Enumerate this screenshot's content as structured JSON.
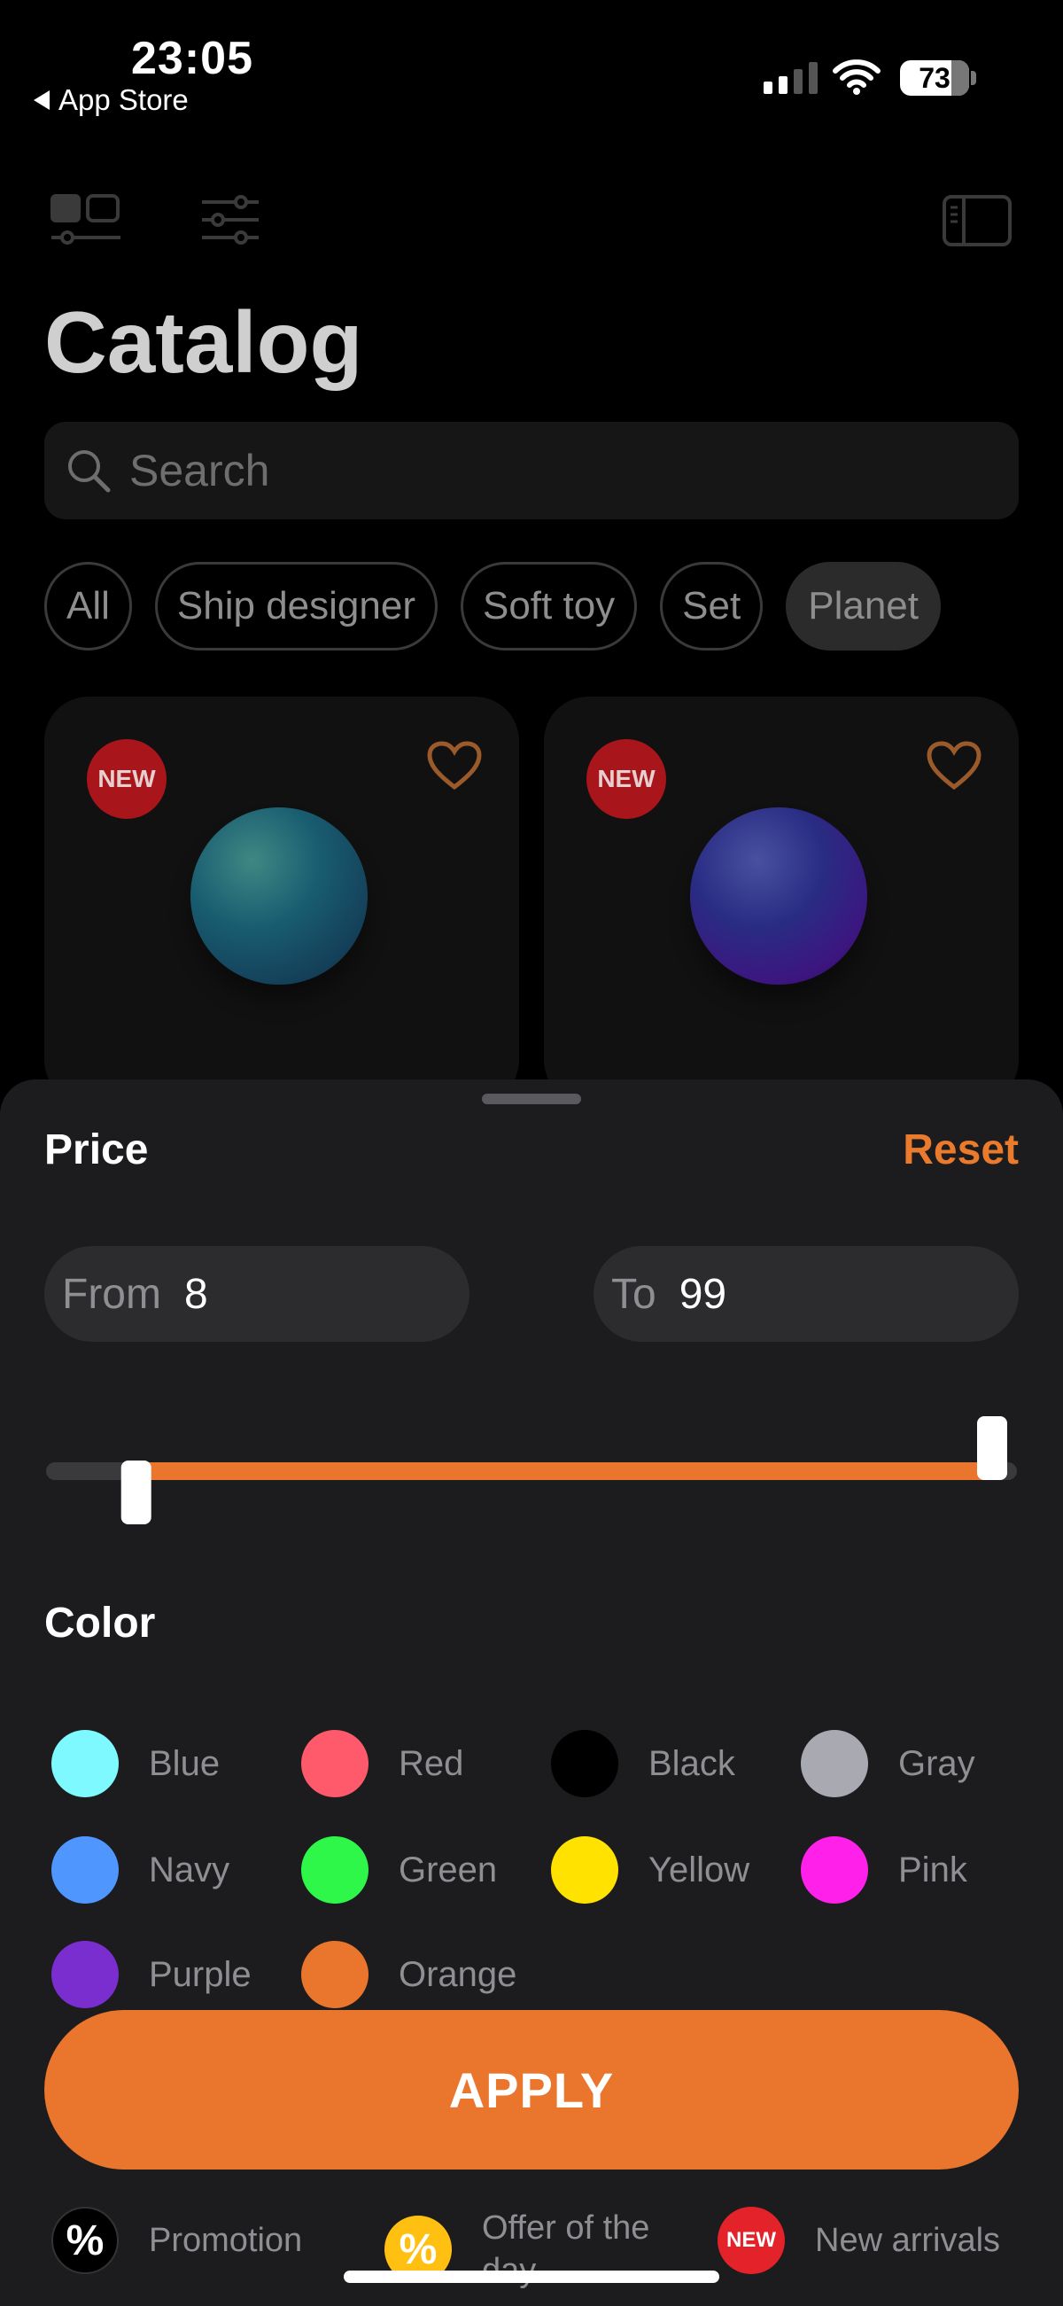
{
  "status_bar": {
    "time": "23:05",
    "back_label": "App Store",
    "battery": "73",
    "icons": [
      "signal-icon",
      "wifi-icon",
      "battery-icon"
    ]
  },
  "toolbar": {
    "icons": [
      "layout-toggle-icon",
      "filter-sliders-icon",
      "sidebar-icon"
    ]
  },
  "page_title": "Catalog",
  "search": {
    "placeholder": "Search"
  },
  "categories": [
    {
      "label": "All",
      "active": false
    },
    {
      "label": "Ship designer",
      "active": false
    },
    {
      "label": "Soft toy",
      "active": false
    },
    {
      "label": "Set",
      "active": false
    },
    {
      "label": "Planet",
      "active": true
    }
  ],
  "products": [
    {
      "badge": "NEW",
      "color": "teal",
      "favorite_icon": "heart-icon"
    },
    {
      "badge": "NEW",
      "color": "purple",
      "favorite_icon": "heart-icon"
    }
  ],
  "filter_sheet": {
    "price_title": "Price",
    "reset_label": "Reset",
    "from_label": "From",
    "from_value": "8",
    "to_label": "To",
    "to_value": "99",
    "slider": {
      "min": 0,
      "max": 99,
      "low": 8,
      "high": 99
    },
    "color_title": "Color",
    "colors": [
      {
        "name": "Blue",
        "hex": "#7ef9ff"
      },
      {
        "name": "Red",
        "hex": "#ff5a6b"
      },
      {
        "name": "Black",
        "hex": "#000000"
      },
      {
        "name": "Gray",
        "hex": "#a9a9b2"
      },
      {
        "name": "Navy",
        "hex": "#4f96ff"
      },
      {
        "name": "Green",
        "hex": "#2ef74a"
      },
      {
        "name": "Yellow",
        "hex": "#ffe200"
      },
      {
        "name": "Pink",
        "hex": "#ff20ea"
      },
      {
        "name": "Purple",
        "hex": "#7a2ed0"
      },
      {
        "name": "Orange",
        "hex": "#ea752c"
      }
    ],
    "apply_label": "APPLY",
    "badges": [
      {
        "label": "Promotion",
        "symbol": "%",
        "bg": "#000000",
        "fg": "#ffffff"
      },
      {
        "label": "Offer of the day",
        "symbol": "%",
        "bg": "#ffc012",
        "fg": "#ffffff"
      },
      {
        "label": "New arrivals",
        "symbol": "NEW",
        "bg": "#e4222a",
        "fg": "#ffffff"
      }
    ]
  },
  "accent_color": "#ea752c"
}
